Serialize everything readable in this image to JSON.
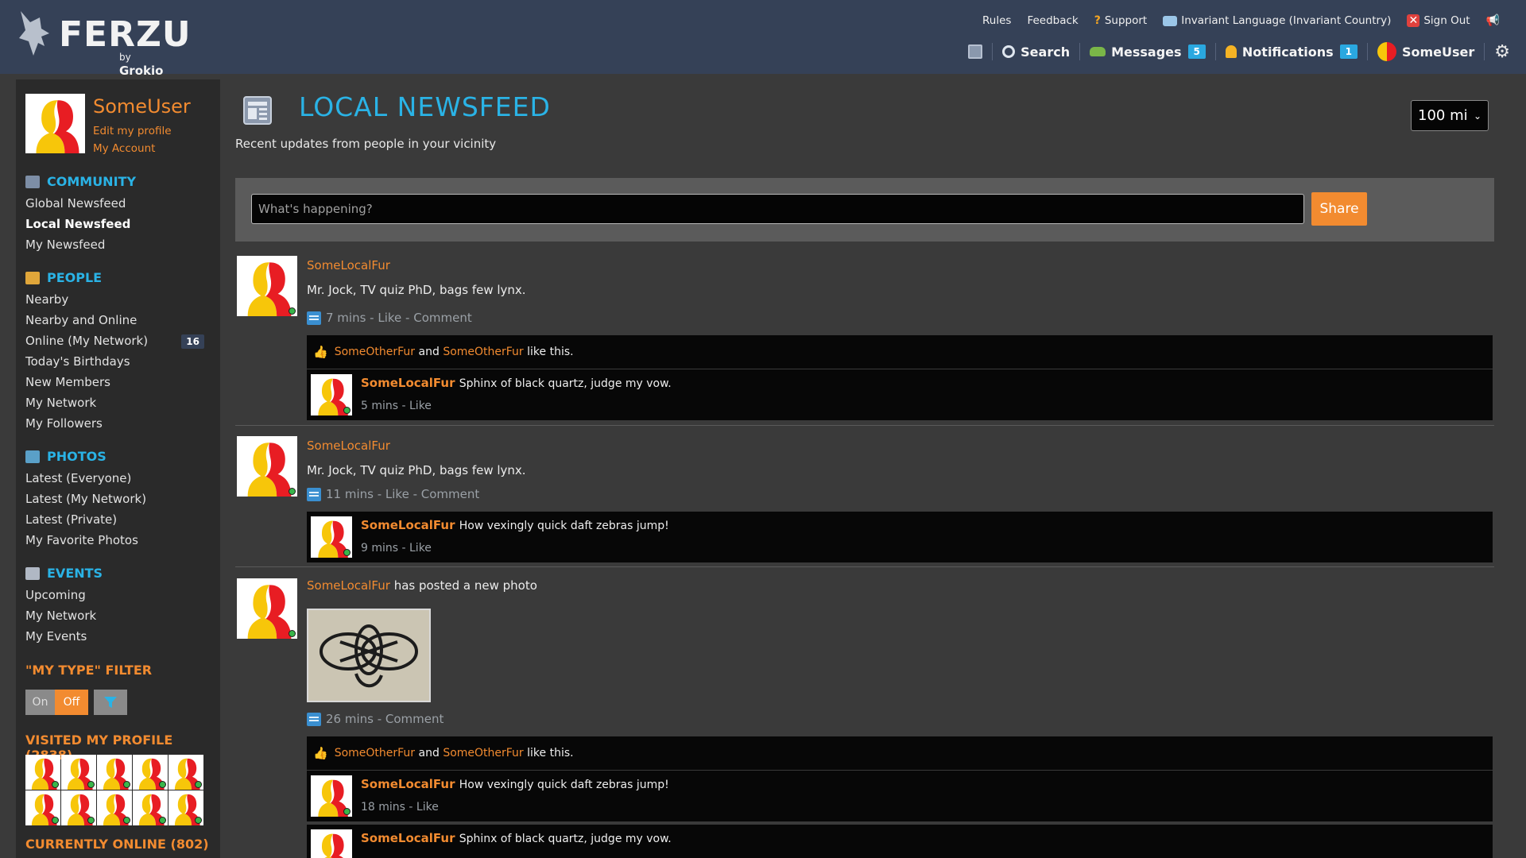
{
  "brand": {
    "name": "FERZU",
    "by_prefix": "by",
    "by_name": "Grokio"
  },
  "topnav": {
    "rules": "Rules",
    "feedback": "Feedback",
    "support": "Support",
    "language": "Invariant Language (Invariant Country)",
    "signout": "Sign Out"
  },
  "mainnav": {
    "search": "Search",
    "messages": "Messages",
    "messages_count": "5",
    "notifications": "Notifications",
    "notifications_count": "1",
    "user": "SomeUser"
  },
  "sidebar": {
    "username": "SomeUser",
    "edit_profile": "Edit my profile",
    "my_account": "My Account",
    "community": {
      "title": "COMMUNITY",
      "items": [
        "Global Newsfeed",
        "Local Newsfeed",
        "My Newsfeed"
      ]
    },
    "people": {
      "title": "PEOPLE",
      "items": [
        "Nearby",
        "Nearby and Online",
        "Online (My Network)",
        "Today's Birthdays",
        "New Members",
        "My Network",
        "My Followers"
      ],
      "online_count": "16"
    },
    "photos": {
      "title": "PHOTOS",
      "items": [
        "Latest (Everyone)",
        "Latest (My Network)",
        "Latest (Private)",
        "My Favorite Photos"
      ]
    },
    "events": {
      "title": "EVENTS",
      "items": [
        "Upcoming",
        "My Network",
        "My Events"
      ]
    },
    "filter": {
      "title": "\"MY TYPE\" FILTER",
      "on": "On",
      "off": "Off"
    },
    "visited_title": "VISITED MY PROFILE (2838)",
    "online_title": "CURRENTLY ONLINE (802)"
  },
  "main": {
    "title": "LOCAL NEWSFEED",
    "subtitle": "Recent updates from people in your vicinity",
    "radius": "100 mi",
    "composer_placeholder": "What's happening?",
    "share": "Share"
  },
  "posts": [
    {
      "author": "SomeLocalFur",
      "text": "Mr. Jock, TV quiz PhD, bags few lynx.",
      "meta": "7 mins - Like - Comment",
      "likers": [
        "SomeOtherFur",
        "SomeOtherFur"
      ],
      "likes_and": "and",
      "likes_suffix": "like this.",
      "comments": [
        {
          "author": "SomeLocalFur",
          "text": "Sphinx of black quartz, judge my vow.",
          "meta": "5 mins - Like"
        }
      ]
    },
    {
      "author": "SomeLocalFur",
      "text": "Mr. Jock, TV quiz PhD, bags few lynx.",
      "meta": "11 mins - Like - Comment",
      "comments": [
        {
          "author": "SomeLocalFur",
          "text": "How vexingly quick daft zebras jump!",
          "meta": "9 mins - Like"
        }
      ]
    },
    {
      "author": "SomeLocalFur",
      "text": "has posted a new photo",
      "meta": "26 mins - Comment",
      "likers": [
        "SomeOtherFur",
        "SomeOtherFur"
      ],
      "likes_and": "and",
      "likes_suffix": "like this.",
      "comments": [
        {
          "author": "SomeLocalFur",
          "text": "How vexingly quick daft zebras jump!",
          "meta": "18 mins - Like"
        },
        {
          "author": "SomeLocalFur",
          "text": "Sphinx of black quartz, judge my vow.",
          "meta": ""
        }
      ]
    }
  ],
  "colors": {
    "header": "#354157",
    "accent_blue": "#2ab3e6",
    "accent_orange": "#f28b30",
    "online": "#39b54a"
  }
}
